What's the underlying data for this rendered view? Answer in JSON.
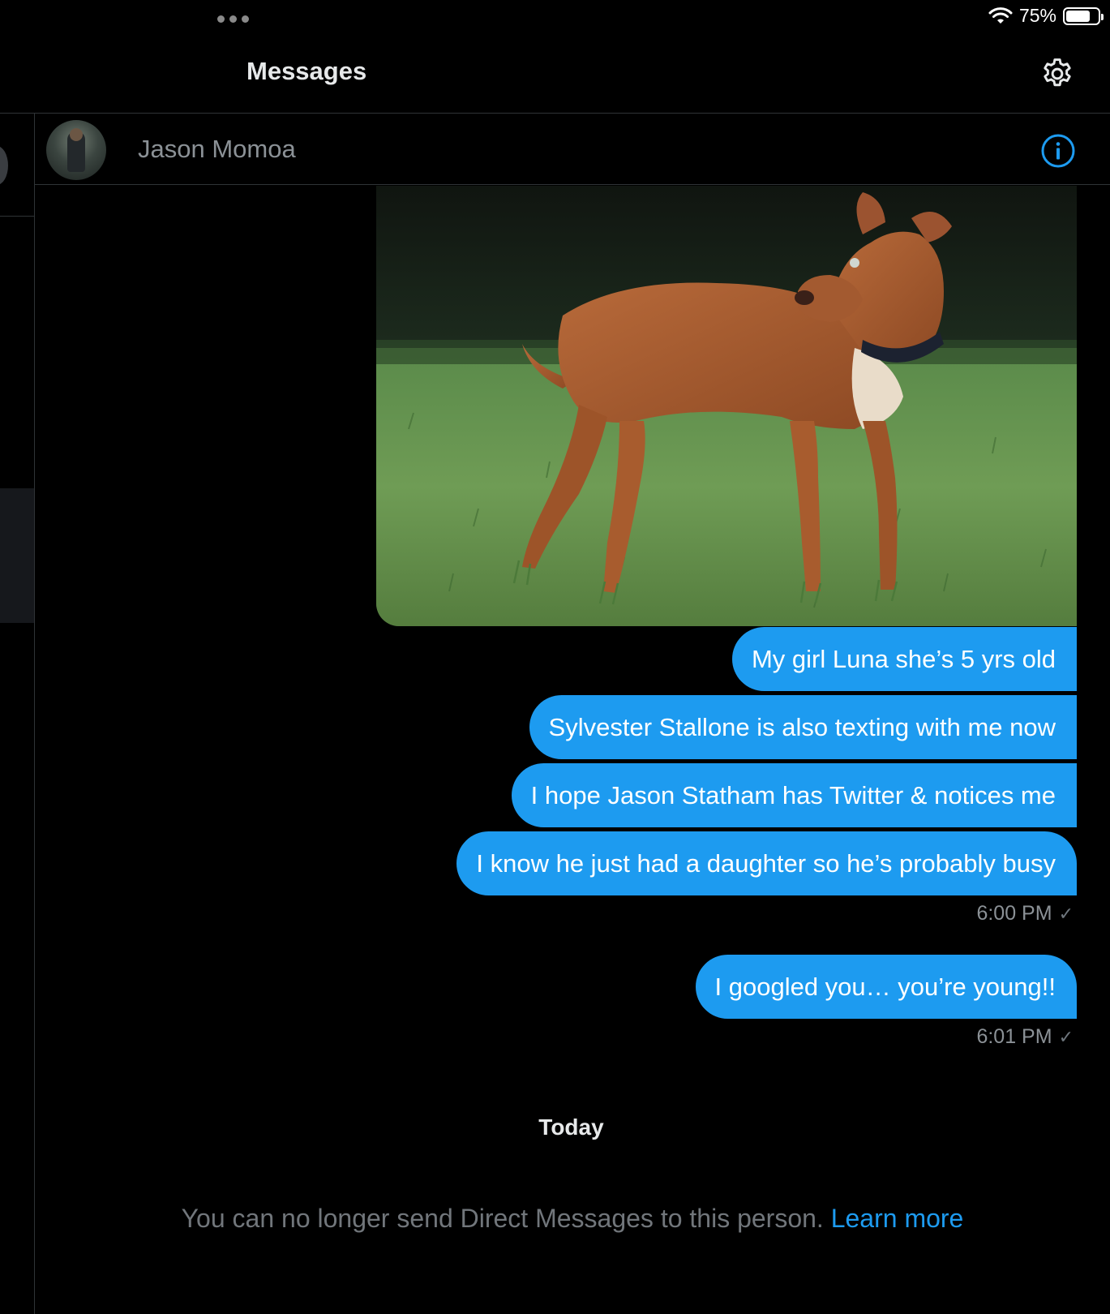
{
  "status_bar": {
    "battery": "75%",
    "battery_level": 0.75
  },
  "header": {
    "title": "Messages"
  },
  "conversation": {
    "name": "Jason Momoa"
  },
  "messages": [
    {
      "text": "My girl Luna she’s 5 yrs old"
    },
    {
      "text": "Sylvester Stallone is also texting with me now"
    },
    {
      "text": "I hope Jason Statham has Twitter & notices me"
    },
    {
      "text": "I know he just had a daughter so he’s probably busy"
    },
    {
      "text": "I googled you… you’re young!!"
    }
  ],
  "timestamps": [
    "6:00 PM",
    "6:01 PM"
  ],
  "day_separator": "Today",
  "notice": {
    "text": "You can no longer send Direct Messages to this person.",
    "link": "Learn more"
  },
  "colors": {
    "accent": "#1d9bf0",
    "background": "#000000",
    "muted_text": "#71767b"
  }
}
